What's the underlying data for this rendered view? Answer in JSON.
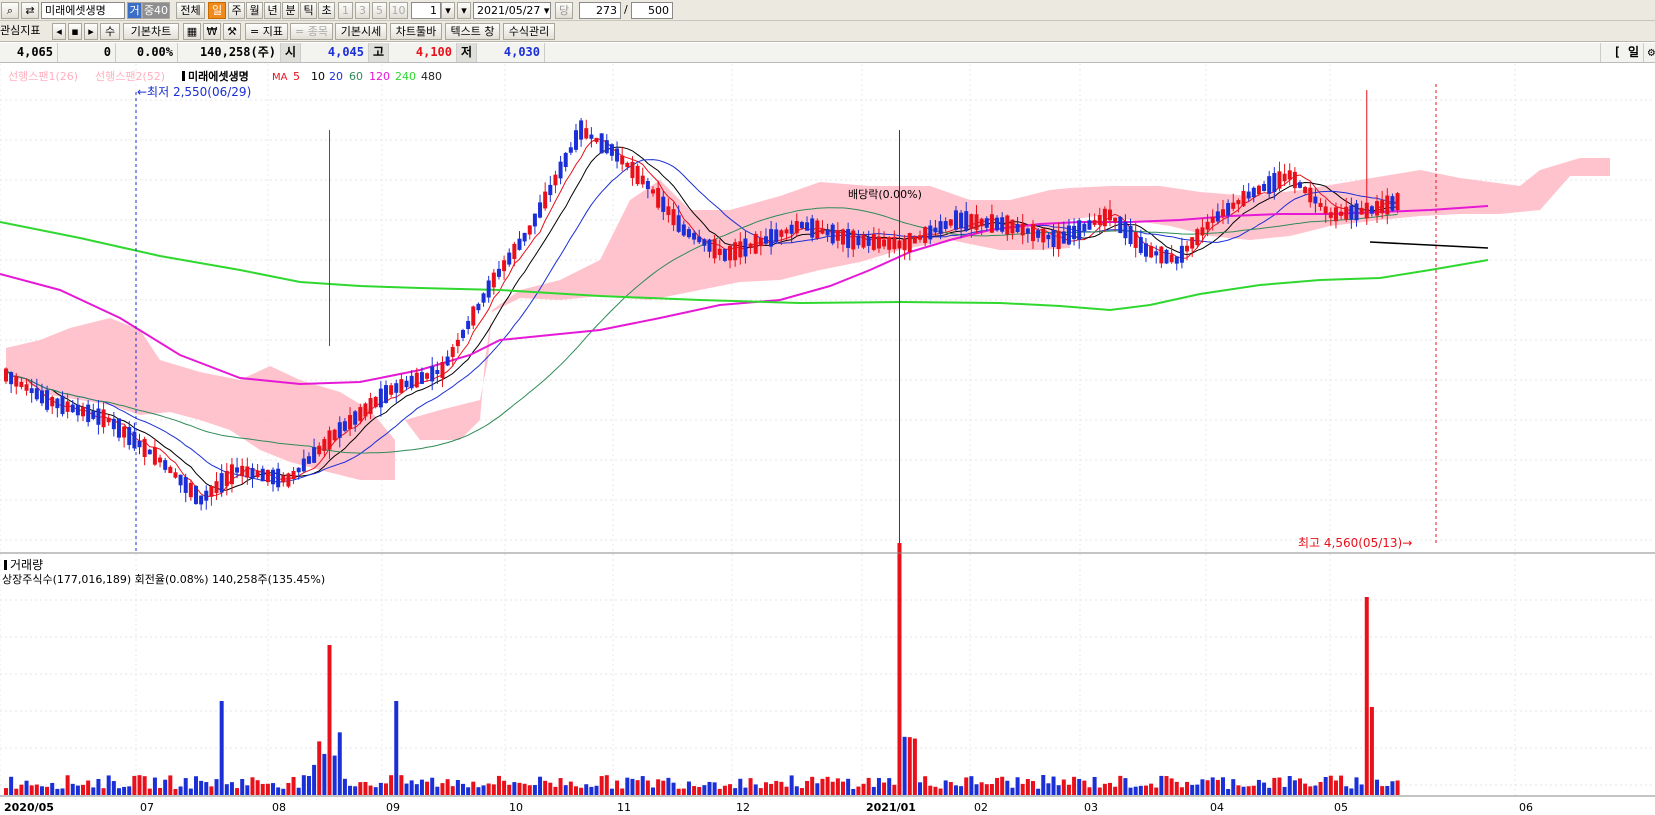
{
  "toolbar1": {
    "stock_name": "미래에셋생명",
    "tag_trade": "거",
    "tag_jung": "중40",
    "period_all": "전체",
    "period_day": "일",
    "period_week": "주",
    "period_month": "월",
    "period_year": "년",
    "period_min": "분",
    "period_tick": "틱",
    "period_sec": "초",
    "n1": "1",
    "n3": "3",
    "n5": "5",
    "n10": "10",
    "unit_value": "1",
    "date_value": "2021/05/27",
    "dang": "당",
    "count_value": "273",
    "slash": "/",
    "total_value": "500"
  },
  "toolbar2": {
    "watchlist": "관심지표",
    "basic_chart": "기본차트",
    "sugwan": "수",
    "indicator": "= 지표",
    "jongmok": "= 종목",
    "basic_quote": "기본시세",
    "chart_toolbar": "차트툴바",
    "text_window": "텍스트 창",
    "formula_mgmt": "수식관리"
  },
  "price_bar": {
    "current": "4,065",
    "change": "0",
    "rate": "0.00%",
    "volume": "140,258(주)",
    "open_label": "시",
    "open": "4,045",
    "high_label": "고",
    "high": "4,100",
    "low_label": "저",
    "low": "4,030",
    "period_tag": "[ 일 ]"
  },
  "legend": {
    "span1": "선행스팬1(26)",
    "span2": "선행스팬2(52)",
    "name": "미래에셋생명",
    "ma_label": "MA",
    "ma": [
      {
        "label": "5",
        "color": "#e8101a"
      },
      {
        "label": "10",
        "color": "#000000"
      },
      {
        "label": "20",
        "color": "#1a2fd6"
      },
      {
        "label": "60",
        "color": "#2e8b57"
      },
      {
        "label": "120",
        "color": "#e619d6"
      },
      {
        "label": "240",
        "color": "#2fd82f"
      },
      {
        "label": "480",
        "color": "#222222"
      }
    ]
  },
  "annotations": {
    "low": "←최저 2,550(06/29)",
    "high": "최고 4,560(05/13)→",
    "dividend": "배당락(0.00%)"
  },
  "volume_panel": {
    "title": "거래량",
    "info": "상장주식수(177,016,189) 회전율(0.08%) 140,258주(135.45%)"
  },
  "x_axis": [
    "2020/05",
    "07",
    "08",
    "09",
    "10",
    "11",
    "12",
    "2021/01",
    "02",
    "03",
    "04",
    "05",
    "06"
  ],
  "colors": {
    "up": "#e8101a",
    "down": "#1a2fd6",
    "cloud": "#ffb8c6",
    "ma120": "#e619d6",
    "ma240": "#2fd82f"
  },
  "chart_data": {
    "type": "candlestick",
    "title": "미래에셋생명",
    "ylim": [
      2550,
      4560
    ],
    "months": [
      "2020/05",
      "07",
      "08",
      "09",
      "10",
      "11",
      "12",
      "2021/01",
      "02",
      "03",
      "04",
      "05",
      "06"
    ],
    "high": {
      "value": 4560,
      "date": "05/13"
    },
    "low": {
      "value": 2550,
      "date": "06/29"
    },
    "last": {
      "open": 4045,
      "high": 4100,
      "low": 4030,
      "close": 4065,
      "volume": 140258
    }
  }
}
